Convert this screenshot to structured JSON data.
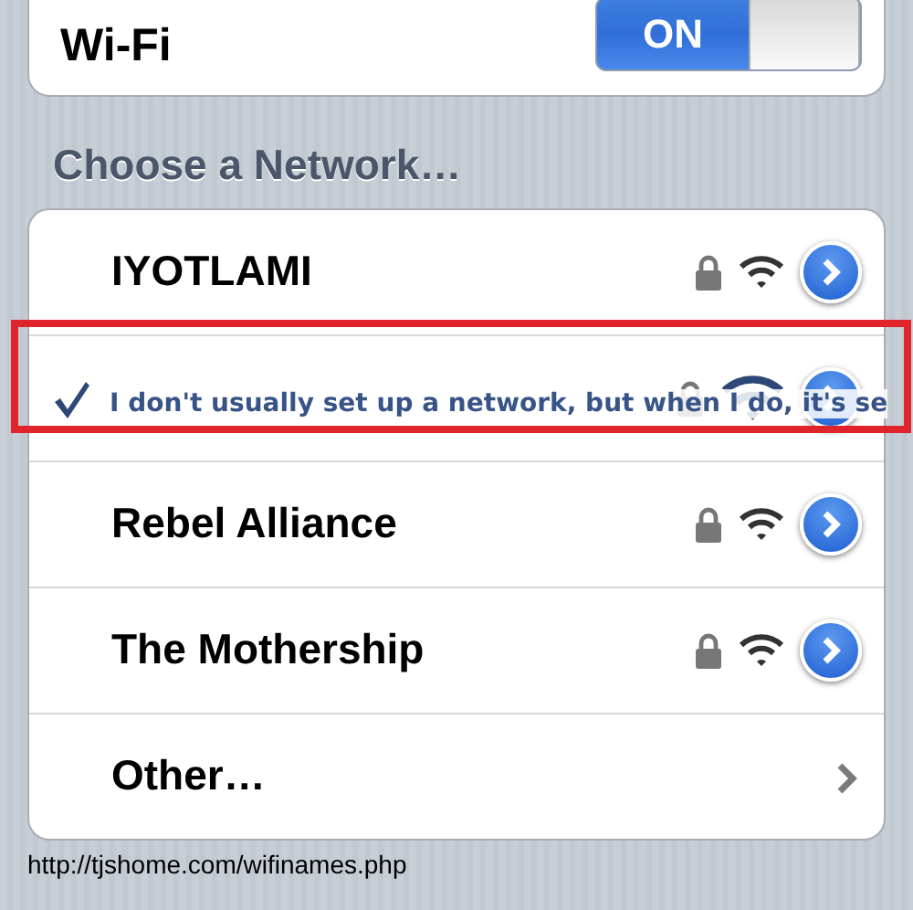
{
  "wifi": {
    "label": "Wi-Fi",
    "on": true,
    "toggle_text": "ON"
  },
  "section_title": "Choose a Network…",
  "networks": [
    {
      "name": "IYOTLAMI",
      "connected": false,
      "secured": true,
      "highlighted": false
    },
    {
      "name": "I don't usually set up a network, but when I do, it's se",
      "connected": true,
      "secured": true,
      "highlighted": true
    },
    {
      "name": "Rebel Alliance",
      "connected": false,
      "secured": true,
      "highlighted": false
    },
    {
      "name": "The Mothership",
      "connected": false,
      "secured": true,
      "highlighted": false
    }
  ],
  "other": {
    "label": "Other…"
  },
  "caption": "http://tjshome.com/wifinames.php"
}
